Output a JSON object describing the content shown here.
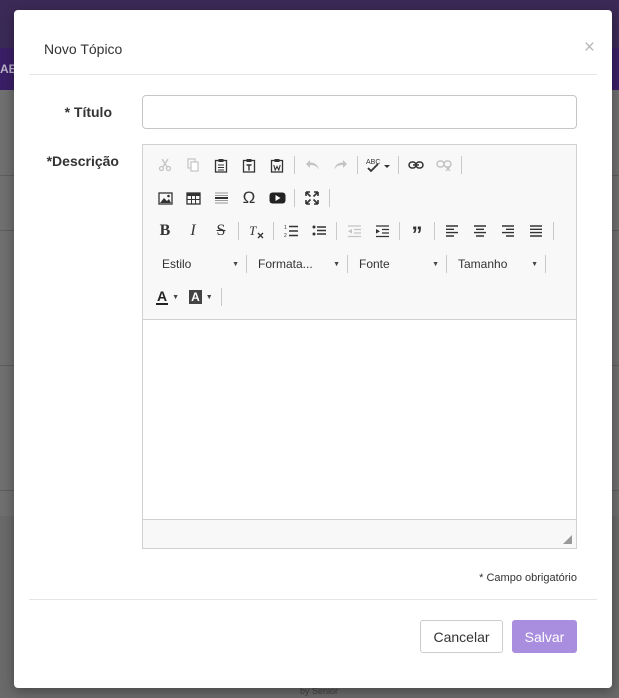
{
  "background": {
    "band_text": "AB",
    "footer_brand": "by Senior"
  },
  "modal": {
    "title": "Novo Tópico",
    "close_symbol": "×",
    "titulo_label": "* Título",
    "titulo_value": "",
    "descricao_label": "*Descrição",
    "editor": {
      "dropdowns": {
        "estilo": "Estilo",
        "formatacao": "Formata...",
        "fonte": "Fonte",
        "tamanho": "Tamanho"
      },
      "color_text_glyph": "A",
      "color_bg_glyph": "A"
    },
    "required_note": "* Campo obrigatório",
    "cancel_label": "Cancelar",
    "save_label": "Salvar"
  },
  "colors": {
    "accent": "#a98ee0",
    "header_purple": "#3a1f66"
  }
}
